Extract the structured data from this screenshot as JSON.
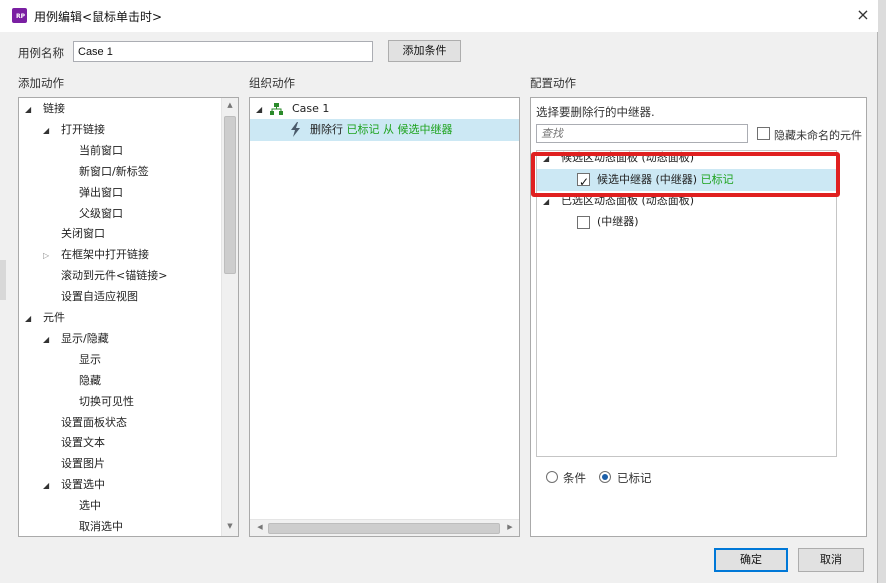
{
  "window": {
    "title": "用例编辑<鼠标单击时>",
    "close_glyph": "×"
  },
  "case_name": {
    "label": "用例名称",
    "value": "Case 1",
    "add_condition_label": "添加条件"
  },
  "add_action": {
    "heading": "添加动作",
    "items": [
      {
        "label": "链接",
        "level": 0,
        "expanded": true
      },
      {
        "label": "打开链接",
        "level": 1,
        "expanded": true
      },
      {
        "label": "当前窗口",
        "level": 2
      },
      {
        "label": "新窗口/新标签",
        "level": 2
      },
      {
        "label": "弹出窗口",
        "level": 2
      },
      {
        "label": "父级窗口",
        "level": 2
      },
      {
        "label": "关闭窗口",
        "level": 1
      },
      {
        "label": "在框架中打开链接",
        "level": 1,
        "expanded": false
      },
      {
        "label": "滚动到元件<锚链接>",
        "level": 1
      },
      {
        "label": "设置自适应视图",
        "level": 1
      },
      {
        "label": "元件",
        "level": 0,
        "expanded": true
      },
      {
        "label": "显示/隐藏",
        "level": 1,
        "expanded": true
      },
      {
        "label": "显示",
        "level": 2
      },
      {
        "label": "隐藏",
        "level": 2
      },
      {
        "label": "切换可见性",
        "level": 2
      },
      {
        "label": "设置面板状态",
        "level": 1
      },
      {
        "label": "设置文本",
        "level": 1
      },
      {
        "label": "设置图片",
        "level": 1
      },
      {
        "label": "设置选中",
        "level": 1,
        "expanded": true
      },
      {
        "label": "选中",
        "level": 2
      },
      {
        "label": "取消选中",
        "level": 2
      }
    ]
  },
  "organize_action": {
    "heading": "组织动作",
    "case_label": "Case 1",
    "action_prefix": "删除行 ",
    "action_marked": "已标记 从 候选中继器"
  },
  "configure_action": {
    "heading": "配置动作",
    "instruction": "选择要删除行的中继器.",
    "search_placeholder": "查找",
    "hide_unnamed_label": "隐藏未命名的元件",
    "tree": {
      "group1_label": "候选区动态面板 (动态面板)",
      "group1_item_label": "候选中继器 (中继器) ",
      "group1_item_marked": "已标记",
      "group1_item_checked": true,
      "group2_label": "已选区动态面板 (动态面板)",
      "group2_item_label": "(中继器)",
      "group2_item_checked": false
    },
    "radio_condition_label": "条件",
    "radio_marked_label": "已标记",
    "selected_radio": "marked"
  },
  "footer": {
    "ok_label": "确定",
    "cancel_label": "取消"
  },
  "colors": {
    "selection": "#cce8f4",
    "marked_text": "#1ea31e",
    "highlight_box": "#e02020"
  }
}
